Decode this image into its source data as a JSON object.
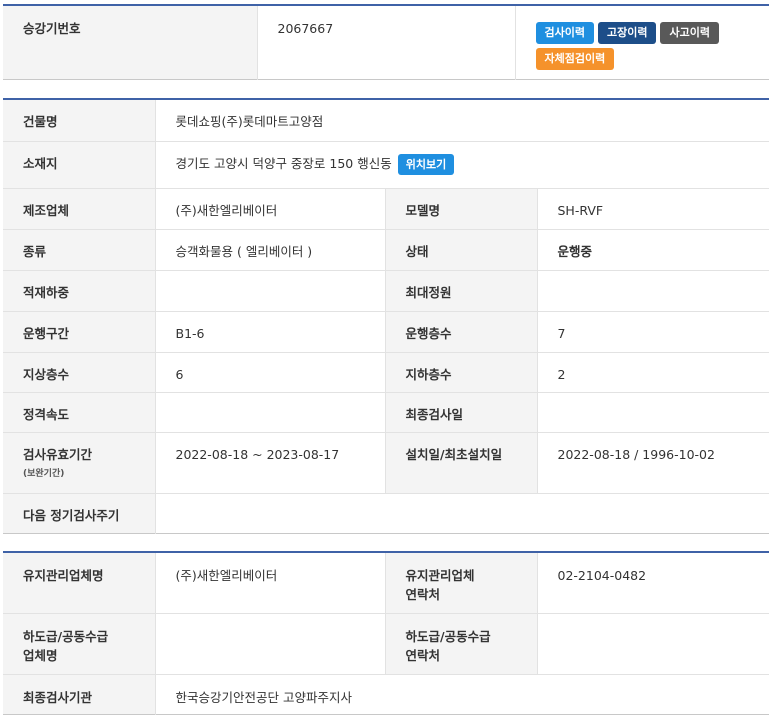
{
  "header": {
    "label": "승강기번호",
    "value": "2067667",
    "buttons": {
      "inspection": "검사이력",
      "failure": "고장이력",
      "accident": "사고이력",
      "self_check": "자체점검이력"
    },
    "colors": {
      "blue": "#1f8fe0",
      "navy": "#1d4e89",
      "gray": "#595959",
      "orange": "#f5922b",
      "accent_line": "#3f62a7"
    }
  },
  "info": {
    "building_label": "건물명",
    "building_value": "롯데쇼핑(주)롯데마트고양점",
    "address_label": "소재지",
    "address_value": "경기도 고양시 덕양구 중장로 150 행신동",
    "location_button": "위치보기",
    "manufacturer_label": "제조업체",
    "manufacturer_value": "(주)새한엘리베이터",
    "model_label": "모델명",
    "model_value": "SH-RVF",
    "type_label": "종류",
    "type_value": "승객화물용 ( 엘리베이터 )",
    "status_label": "상태",
    "status_value": "운행중",
    "load_label": "적재하중",
    "load_value": "",
    "capacity_label": "최대정원",
    "capacity_value": "",
    "section_label": "운행구간",
    "section_value": "B1-6",
    "floors_label": "운행층수",
    "floors_value": "7",
    "above_label": "지상층수",
    "above_value": "6",
    "below_label": "지하층수",
    "below_value": "2",
    "speed_label": "정격속도",
    "speed_value": "",
    "last_insp_label": "최종검사일",
    "last_insp_value": "",
    "validity_label": "검사유효기간",
    "validity_sub": "(보완기간)",
    "validity_value": "2022-08-18 ~ 2023-08-17",
    "install_label": "설치일/최초설치일",
    "install_value": "2022-08-18 / 1996-10-02",
    "next_cycle_label": "다음 정기검사주기",
    "next_cycle_value": ""
  },
  "maintenance": {
    "company_label": "유지관리업체명",
    "company_value": "(주)새한엘리베이터",
    "contact_label_1": "유지관리업체",
    "contact_label_2": "연락처",
    "contact_value": "02-2104-0482",
    "sub_label_1": "하도급/공동수급",
    "sub_label_2": "업체명",
    "sub_value": "",
    "sub_contact_label_1": "하도급/공동수급",
    "sub_contact_label_2": "연락처",
    "sub_contact_value": "",
    "agency_label": "최종검사기관",
    "agency_value": "한국승강기안전공단 고양파주지사"
  }
}
